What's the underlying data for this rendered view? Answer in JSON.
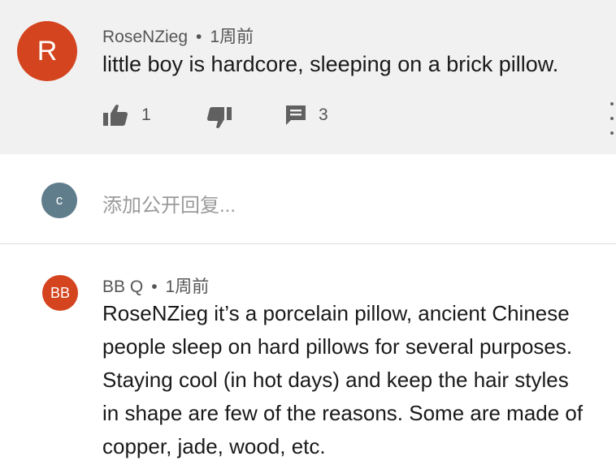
{
  "comment1": {
    "avatar_letter": "R",
    "avatar_color": "#d4441f",
    "author": "RoseNZieg",
    "separator": "•",
    "time": "1周前",
    "text": "little boy is hardcore, sleeping on a brick pillow.",
    "likes": "1",
    "replies": "3",
    "icons": [
      "thumbs-up-icon",
      "thumbs-down-icon",
      "comment-icon",
      "more-vertical-icon"
    ]
  },
  "reply_box": {
    "avatar_letter": "c",
    "avatar_color": "#607d8b",
    "placeholder": "添加公开回复..."
  },
  "comment2": {
    "avatar_letter": "BB",
    "avatar_color": "#d4441f",
    "author": "BB Q",
    "separator": "•",
    "time": "1周前",
    "text_lines": [
      "RoseNZieg it’s a porcelain pillow, ancient Chinese",
      "people sleep on hard pillows for several purposes.",
      "Staying cool (in hot days) and keep the hair styles",
      "in shape are few of the reasons. Some are made of",
      "copper, jade, wood, etc."
    ]
  }
}
